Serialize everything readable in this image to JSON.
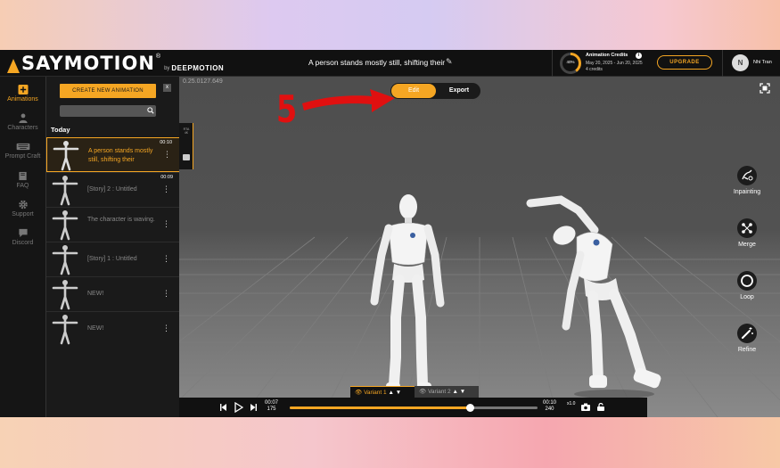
{
  "app": {
    "logo_text": "SAYMOTION",
    "logo_reg": "®",
    "logo_by": "by",
    "logo_company": "DEEPMOTION"
  },
  "header": {
    "title": "A person stands mostly still, shifting their",
    "credits": {
      "title": "Animation Credits",
      "percent": "40%",
      "percent_value": 0.4,
      "dates": "May 20, 2025 - Jun 20, 2025",
      "amount": "4 credits"
    },
    "upgrade_label": "UPGRADE",
    "user": {
      "initial": "N",
      "name": "Nhi Tran"
    }
  },
  "nav": {
    "items": [
      {
        "label": "Animations",
        "icon": "plus-square-icon",
        "active": true
      },
      {
        "label": "Characters",
        "icon": "person-icon",
        "active": false
      },
      {
        "label": "Prompt Craft",
        "icon": "keyboard-icon",
        "active": false
      },
      {
        "label": "FAQ",
        "icon": "book-icon",
        "active": false
      },
      {
        "label": "Support",
        "icon": "gear-icon",
        "active": false
      },
      {
        "label": "Discord",
        "icon": "chat-icon",
        "active": false
      }
    ]
  },
  "panel": {
    "create_label": "CREATE NEW ANIMATION",
    "close_label": "x",
    "search_placeholder": "",
    "section_label": "Today",
    "items": [
      {
        "title": "A person stands mostly still, shifting their",
        "duration": "00:10",
        "selected": true
      },
      {
        "title": "[Story] 2 : Untitled",
        "duration": "00:09",
        "selected": false
      },
      {
        "title": "The character is waving.",
        "duration": "",
        "selected": false
      },
      {
        "title": "[Story] 1 : Untitled",
        "duration": "",
        "selected": false
      },
      {
        "title": "NEW!",
        "duration": "",
        "selected": false
      },
      {
        "title": "NEW!",
        "duration": "",
        "selected": false
      }
    ]
  },
  "viewport": {
    "version": "0.25.0127.649",
    "side_tab_text": "RTA 4K",
    "edit_label": "Edit",
    "export_label": "Export",
    "annotation_number": "5",
    "annotation_color": "#e01010",
    "tools": [
      {
        "label": "Inpainting",
        "icon": "inpainting-icon"
      },
      {
        "label": "Merge",
        "icon": "merge-icon"
      },
      {
        "label": "Loop",
        "icon": "loop-icon"
      },
      {
        "label": "Refine",
        "icon": "magic-wand-icon"
      }
    ],
    "variants": [
      {
        "label": "Variant 1",
        "active": true
      },
      {
        "label": "Variant 2",
        "active": false
      }
    ]
  },
  "player": {
    "current_time": "00:07",
    "current_frame": "175",
    "end_time": "00:10",
    "end_frame": "240",
    "speed_label": "x1.0",
    "speed_sub": "",
    "progress": 0.729
  },
  "colors": {
    "accent": "#f5a623",
    "background": "#1e1e1e"
  }
}
